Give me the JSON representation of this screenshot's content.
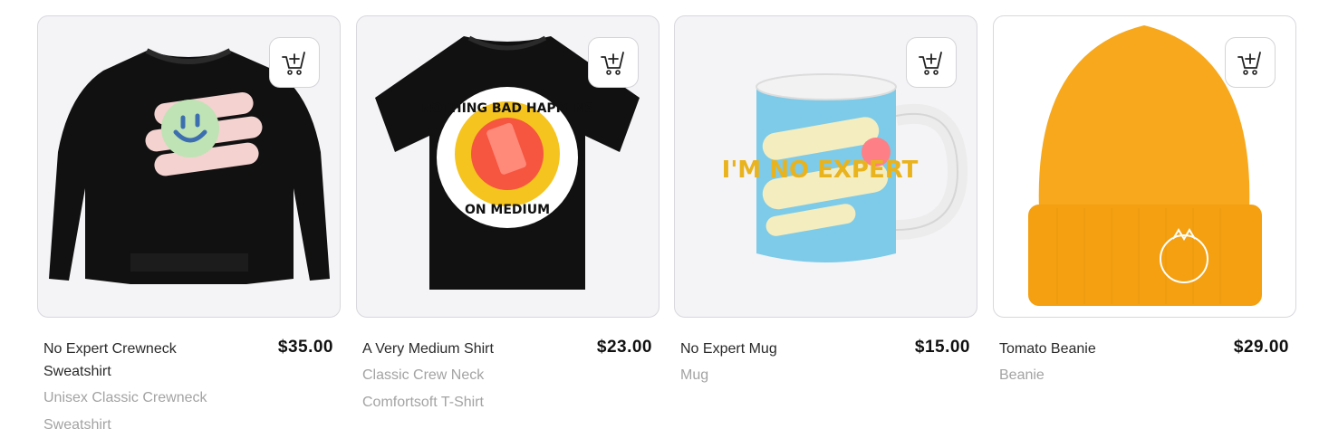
{
  "products": [
    {
      "name": "No Expert Crewneck Sweatshirt",
      "price": "$35.00",
      "subtitle": "Unisex Classic Crewneck Sweatshirt",
      "image_icon": "sweatshirt-image",
      "cart_icon": "add-to-cart-icon"
    },
    {
      "name": "A Very Medium Shirt",
      "price": "$23.00",
      "subtitle": "Classic Crew Neck Comfortsoft T-Shirt",
      "image_icon": "tshirt-image",
      "cart_icon": "add-to-cart-icon",
      "graphic_text_top": "NOTHING BAD HAPPENS",
      "graphic_text_bottom": "ON MEDIUM"
    },
    {
      "name": "No Expert Mug",
      "price": "$15.00",
      "subtitle": "Mug",
      "image_icon": "mug-image",
      "cart_icon": "add-to-cart-icon",
      "graphic_text": "I'M NO EXPERT"
    },
    {
      "name": "Tomato Beanie",
      "price": "$29.00",
      "subtitle": "Beanie",
      "image_icon": "beanie-image",
      "cart_icon": "add-to-cart-icon"
    }
  ],
  "colors": {
    "card_bg": "#f4f4f7",
    "border": "#d8d8dd",
    "price": "#111111",
    "subtitle": "#a3a3a3",
    "beanie": "#f7a81c",
    "mug": "#7dcbe8"
  }
}
